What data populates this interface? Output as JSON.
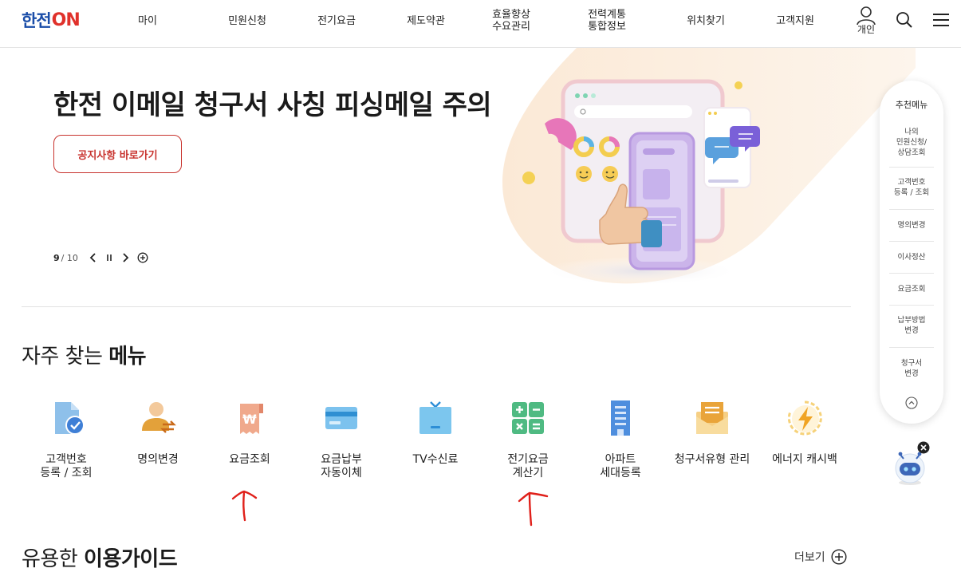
{
  "header": {
    "logo_text": "한전",
    "logo_on": "ON",
    "nav": [
      "마이",
      "민원신청",
      "전기요금",
      "제도약관",
      "효율향상\n수요관리",
      "전력계통\n통합정보",
      "위치찾기",
      "고객지원"
    ],
    "personal_label": "개인",
    "icons": {
      "user": "user-icon",
      "search": "search-icon",
      "menu": "hamburger-menu-icon"
    }
  },
  "hero": {
    "title": "한전 이메일 청구서 사칭 피싱메일 주의",
    "button_label": "공지사항 바로가기",
    "pager_current": "9",
    "pager_total": "/ 10"
  },
  "frequent": {
    "title_plain": "자주 찾는 ",
    "title_bold": "메뉴",
    "items": [
      {
        "label": "고객번호\n등록 / 조회",
        "icon": "document-check-icon"
      },
      {
        "label": "명의변경",
        "icon": "person-change-icon"
      },
      {
        "label": "요금조회",
        "icon": "won-receipt-icon"
      },
      {
        "label": "요금납부\n자동이체",
        "icon": "credit-card-icon"
      },
      {
        "label": "TV수신료",
        "icon": "tv-icon"
      },
      {
        "label": "전기요금\n계산기",
        "icon": "calculator-icon"
      },
      {
        "label": "아파트\n세대등록",
        "icon": "apartment-icon"
      },
      {
        "label": "청구서유형 관리",
        "icon": "envelope-icon"
      },
      {
        "label": "에너지 캐시백",
        "icon": "energy-cashback-icon"
      }
    ]
  },
  "guide": {
    "title_plain": "유용한 ",
    "title_bold": "이용가이드",
    "more_label": "더보기"
  },
  "quick_menu": {
    "title": "추천메뉴",
    "items": [
      "나의\n민원신청/\n상담조회",
      "고객번호\n등록 / 조회",
      "명의변경",
      "이사정산",
      "요금조회",
      "납부방법\n변경",
      "청구서\n변경"
    ]
  },
  "colors": {
    "brand_blue": "#1a4da8",
    "brand_red": "#e0312b",
    "notice_red": "#c8332e",
    "annotation_red": "#e0201a"
  }
}
